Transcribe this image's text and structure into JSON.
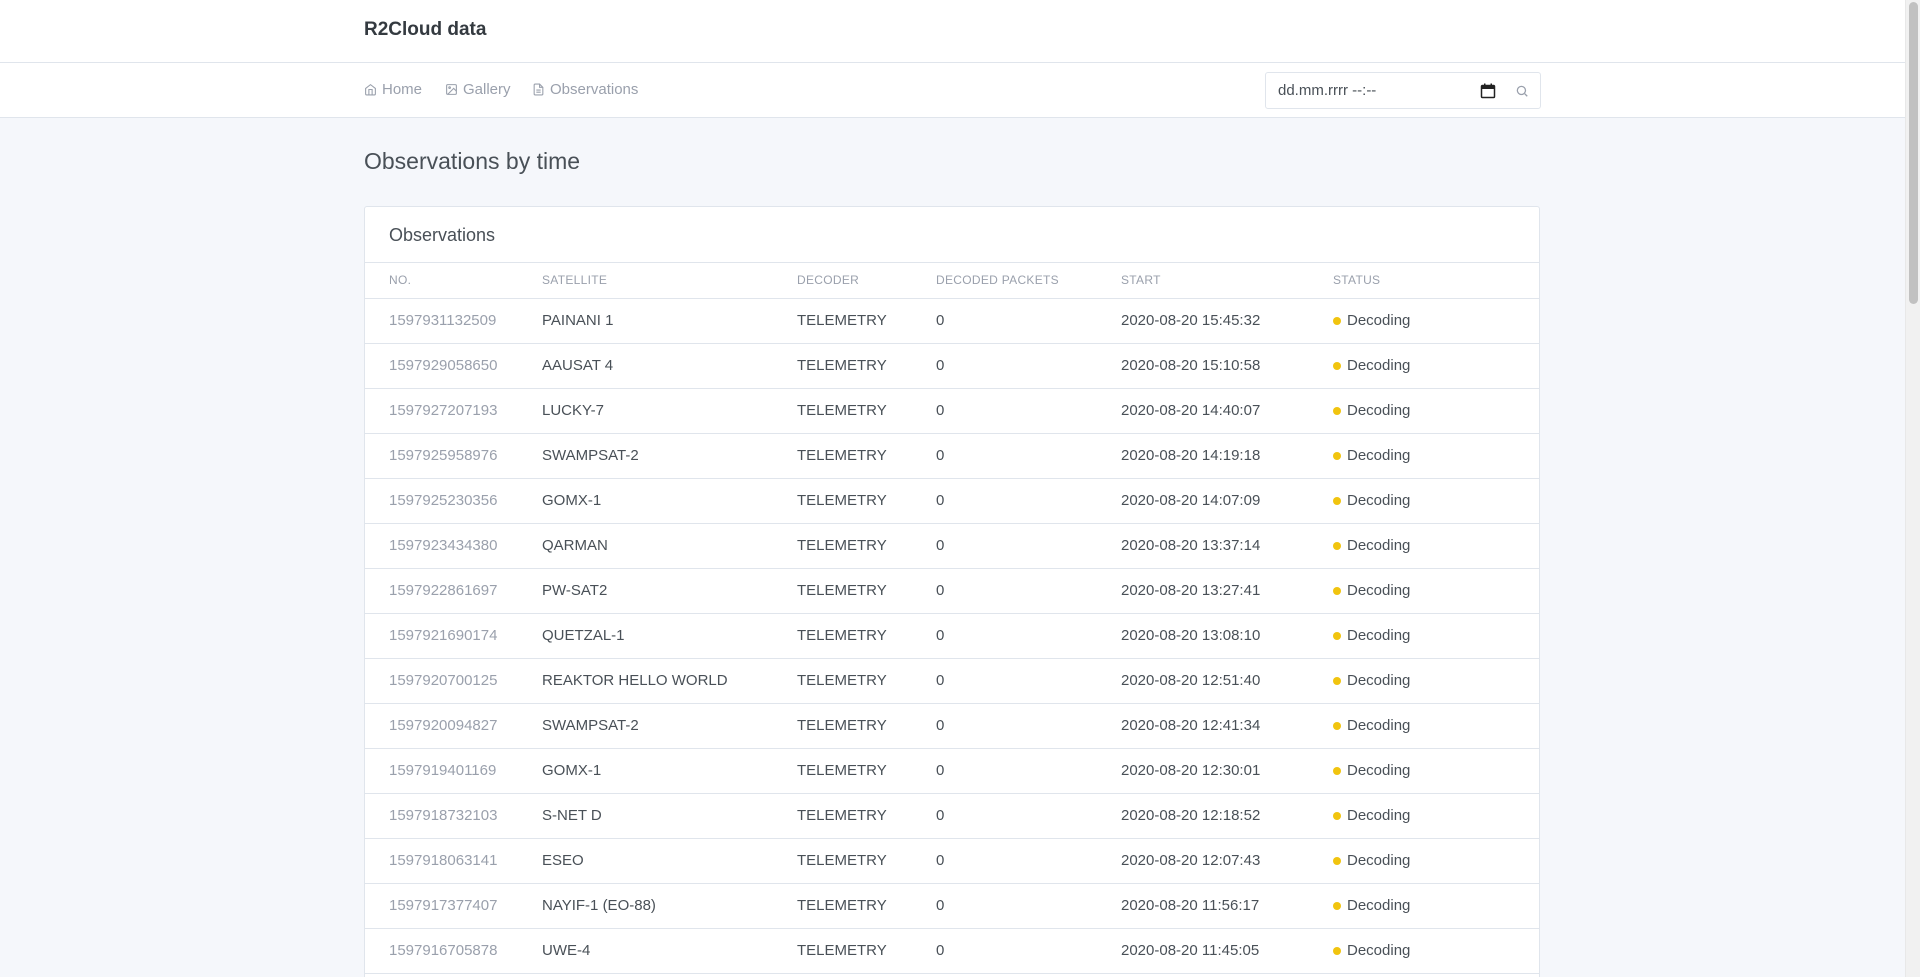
{
  "brand": "R2Cloud data",
  "nav": {
    "home": "Home",
    "gallery": "Gallery",
    "observations": "Observations"
  },
  "search": {
    "placeholder": "dd.mm.rrrr --:--"
  },
  "page_title": "Observations by time",
  "card_title": "Observations",
  "table": {
    "headers": [
      "No.",
      "Satellite",
      "Decoder",
      "Decoded packets",
      "Start",
      "Status"
    ],
    "rows": [
      {
        "no": "1597931132509",
        "satellite": "PAINANI 1",
        "decoder": "TELEMETRY",
        "packets": "0",
        "start": "2020-08-20 15:45:32",
        "status": "Decoding"
      },
      {
        "no": "1597929058650",
        "satellite": "AAUSAT 4",
        "decoder": "TELEMETRY",
        "packets": "0",
        "start": "2020-08-20 15:10:58",
        "status": "Decoding"
      },
      {
        "no": "1597927207193",
        "satellite": "LUCKY-7",
        "decoder": "TELEMETRY",
        "packets": "0",
        "start": "2020-08-20 14:40:07",
        "status": "Decoding"
      },
      {
        "no": "1597925958976",
        "satellite": "SWAMPSAT-2",
        "decoder": "TELEMETRY",
        "packets": "0",
        "start": "2020-08-20 14:19:18",
        "status": "Decoding"
      },
      {
        "no": "1597925230356",
        "satellite": "GOMX-1",
        "decoder": "TELEMETRY",
        "packets": "0",
        "start": "2020-08-20 14:07:09",
        "status": "Decoding"
      },
      {
        "no": "1597923434380",
        "satellite": "QARMAN",
        "decoder": "TELEMETRY",
        "packets": "0",
        "start": "2020-08-20 13:37:14",
        "status": "Decoding"
      },
      {
        "no": "1597922861697",
        "satellite": "PW-SAT2",
        "decoder": "TELEMETRY",
        "packets": "0",
        "start": "2020-08-20 13:27:41",
        "status": "Decoding"
      },
      {
        "no": "1597921690174",
        "satellite": "QUETZAL-1",
        "decoder": "TELEMETRY",
        "packets": "0",
        "start": "2020-08-20 13:08:10",
        "status": "Decoding"
      },
      {
        "no": "1597920700125",
        "satellite": "REAKTOR HELLO WORLD",
        "decoder": "TELEMETRY",
        "packets": "0",
        "start": "2020-08-20 12:51:40",
        "status": "Decoding"
      },
      {
        "no": "1597920094827",
        "satellite": "SWAMPSAT-2",
        "decoder": "TELEMETRY",
        "packets": "0",
        "start": "2020-08-20 12:41:34",
        "status": "Decoding"
      },
      {
        "no": "1597919401169",
        "satellite": "GOMX-1",
        "decoder": "TELEMETRY",
        "packets": "0",
        "start": "2020-08-20 12:30:01",
        "status": "Decoding"
      },
      {
        "no": "1597918732103",
        "satellite": "S-NET D",
        "decoder": "TELEMETRY",
        "packets": "0",
        "start": "2020-08-20 12:18:52",
        "status": "Decoding"
      },
      {
        "no": "1597918063141",
        "satellite": "ESEO",
        "decoder": "TELEMETRY",
        "packets": "0",
        "start": "2020-08-20 12:07:43",
        "status": "Decoding"
      },
      {
        "no": "1597917377407",
        "satellite": "NAYIF-1 (EO-88)",
        "decoder": "TELEMETRY",
        "packets": "0",
        "start": "2020-08-20 11:56:17",
        "status": "Decoding"
      },
      {
        "no": "1597916705878",
        "satellite": "UWE-4",
        "decoder": "TELEMETRY",
        "packets": "0",
        "start": "2020-08-20 11:45:05",
        "status": "Decoding"
      }
    ]
  },
  "colors": {
    "status_decoding": "#f1c40f",
    "muted": "#9aa0ac",
    "text": "#495057"
  }
}
